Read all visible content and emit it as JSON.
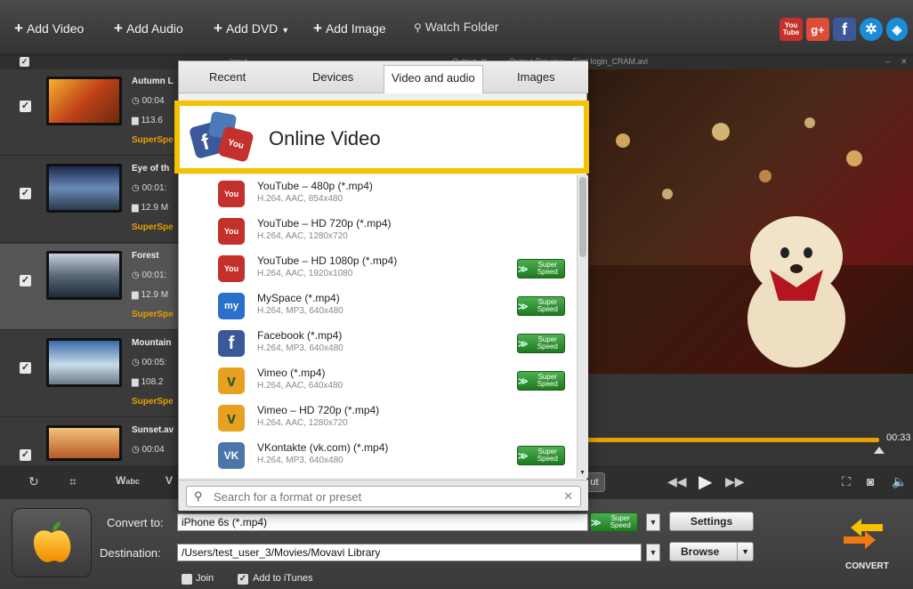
{
  "toolbar": {
    "add_video": "Add Video",
    "add_audio": "Add Audio",
    "add_dvd": "Add DVD",
    "add_image": "Add Image",
    "watch_folder": "Watch Folder"
  },
  "social": {
    "youtube": "You Tube",
    "gplus": "g+",
    "facebook": "f"
  },
  "columns": {
    "input": "Input",
    "output": "Output",
    "output_preview": "Output Preview – First login_CRAM.avi"
  },
  "files": [
    {
      "name": "Autumn L",
      "duration": "00:04",
      "size": "113.6",
      "badge": "SuperSpe"
    },
    {
      "name": "Eye of th",
      "duration": "00:01:",
      "size": "12.9 M",
      "badge": "SuperSpe"
    },
    {
      "name": "Forest",
      "duration": "00:01:",
      "size": "12.9 M",
      "badge": "SuperSpe"
    },
    {
      "name": "Mountain",
      "duration": "00:05:",
      "size": "108.2",
      "badge": "SuperSpe"
    },
    {
      "name": "Sunset.av",
      "duration": "00:04",
      "size": "",
      "badge": ""
    }
  ],
  "popup": {
    "tabs": [
      "Recent",
      "Devices",
      "Video and audio",
      "Images"
    ],
    "active_tab": "Video and audio",
    "category": "Online Video",
    "presets": [
      {
        "name": "YouTube – 480p (*.mp4)",
        "details": "H.264, AAC, 854x480",
        "icon": "youtube-icon",
        "superspeed": false
      },
      {
        "name": "YouTube – HD 720p (*.mp4)",
        "details": "H.264, AAC, 1280x720",
        "icon": "youtube-icon",
        "superspeed": false
      },
      {
        "name": "YouTube – HD 1080p (*.mp4)",
        "details": "H.264, AAC, 1920x1080",
        "icon": "youtube-icon",
        "superspeed": true
      },
      {
        "name": "MySpace (*.mp4)",
        "details": "H.264, MP3, 640x480",
        "icon": "myspace-icon",
        "superspeed": true
      },
      {
        "name": "Facebook (*.mp4)",
        "details": "H.264, MP3, 640x480",
        "icon": "facebook-icon",
        "superspeed": true
      },
      {
        "name": "Vimeo (*.mp4)",
        "details": "H.264, AAC, 640x480",
        "icon": "vimeo-icon",
        "superspeed": true
      },
      {
        "name": "Vimeo – HD 720p (*.mp4)",
        "details": "H.264, AAC, 1280x720",
        "icon": "vimeo-icon",
        "superspeed": false
      },
      {
        "name": "VKontakte (vk.com) (*.mp4)",
        "details": "H.264, MP3, 640x480",
        "icon": "vk-icon",
        "superspeed": true
      }
    ],
    "search_placeholder": "Search for a format or preset",
    "superspeed_label": "Super Speed"
  },
  "timeline": {
    "time": "00:33"
  },
  "ctrlbar": {
    "watermark": "W",
    "watermark_sub": "abc",
    "out_btn": "ut"
  },
  "convert": {
    "convert_to_label": "Convert to:",
    "convert_to_value": "iPhone 6s (*.mp4)",
    "destination_label": "Destination:",
    "destination_value": "/Users/test_user_3/Movies/Movavi Library",
    "settings": "Settings",
    "browse": "Browse",
    "join": "Join",
    "add_to_itunes": "Add to iTunes",
    "convert_button": "CONVERT"
  },
  "colors": {
    "accent_yellow": "#f5c100",
    "superspeed_green": "#2e8b2e",
    "timeline_orange": "#e6a000"
  }
}
